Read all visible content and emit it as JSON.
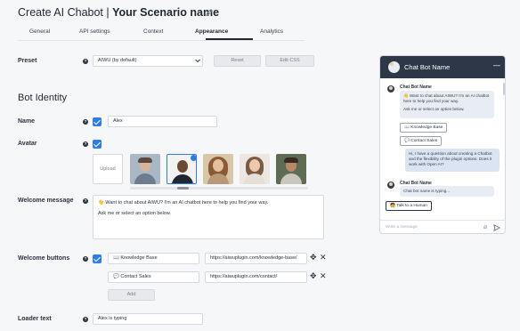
{
  "header": {
    "title_prefix": "Create AI Chabot | ",
    "title_name": "Your Scenario name"
  },
  "tabs": [
    {
      "label": "General"
    },
    {
      "label": "API settings"
    },
    {
      "label": "Context"
    },
    {
      "label": "Appearance"
    },
    {
      "label": "Analytics"
    }
  ],
  "preset": {
    "label": "Preset",
    "value": "AIWU (by default)",
    "reset_label": "Reset",
    "edit_css_label": "Edit CSS"
  },
  "bot_identity": {
    "section_title": "Bot Identity",
    "name_label": "Name",
    "name_value": "Alex",
    "avatar_label": "Avatar",
    "upload_label": "Upload"
  },
  "welcome_message": {
    "label": "Welcome message",
    "line1": "👋 Want to chat about AIWU? I'm an AI chatbot here to help you find your way.",
    "line2": "Ask me or select an option below."
  },
  "welcome_buttons": {
    "label": "Welcome buttons",
    "rows": [
      {
        "text": "📖 Knowledge Base",
        "url": "https://aiwuplugin.com/knowledge-base/"
      },
      {
        "text": "💬 Contact Sales",
        "url": "https://aiwuplugin.com/contact/"
      }
    ],
    "add_label": "Add"
  },
  "loader": {
    "label": "Loader text",
    "value": "Alex is typing"
  },
  "chat_preview": {
    "header_title": "Chat Bot Name",
    "bot_name": "Chat Bot Name",
    "welcome_line1": "👋 Want to chat about AIWU? I'm an AI chatbot here to help you find your way.",
    "welcome_line2": "Ask me or select an option below.",
    "chip1": "📖 Knowledge Base",
    "chip2": "💬 Contact Sales",
    "user_message": "Hi, I have a question about creating a Chatbot and the flexibility of the plugin options. Does it work with Open AI?",
    "bot_name2": "Chat Bot Name",
    "typing": "Chat bot name is typing...",
    "talk_human": "🧑 Talk to a Human",
    "input_placeholder": "Write a message"
  },
  "icons": {
    "pencil": "pencil-icon",
    "help": "question-icon",
    "move": "move-icon",
    "remove": "close-icon",
    "attach": "paperclip-icon",
    "send": "send-icon"
  },
  "colors": {
    "accent": "#2f7de1",
    "chat_header": "#2d3748",
    "bubble": "#e8ecf3"
  }
}
